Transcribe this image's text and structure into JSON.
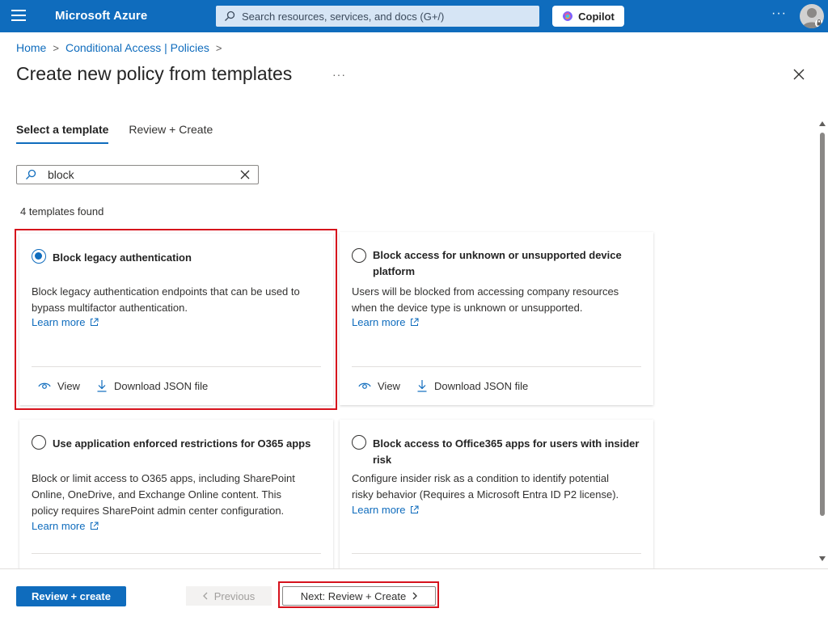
{
  "topbar": {
    "brand": "Microsoft Azure",
    "search_placeholder": "Search resources, services, and docs (G+/)",
    "copilot_label": "Copilot",
    "more_label": "···"
  },
  "breadcrumb": {
    "items": [
      "Home",
      "Conditional Access | Policies"
    ],
    "separator": ">"
  },
  "page": {
    "title": "Create new policy from templates",
    "title_more": "···"
  },
  "tabs": [
    {
      "label": "Select a template",
      "active": true
    },
    {
      "label": "Review + Create",
      "active": false
    }
  ],
  "filter": {
    "value": "block"
  },
  "results_count": "4 templates found",
  "cards": [
    {
      "title": "Block legacy authentication",
      "selected": true,
      "description": "Block legacy authentication endpoints that can be used to bypass multifactor authentication.",
      "learn_more": "Learn more",
      "view_label": "View",
      "download_label": "Download JSON file"
    },
    {
      "title": "Block access for unknown or unsupported device platform",
      "selected": false,
      "description": "Users will be blocked from accessing company resources when the device type is unknown or unsupported.",
      "learn_more": "Learn more",
      "view_label": "View",
      "download_label": "Download JSON file"
    },
    {
      "title": "Use application enforced restrictions for O365 apps",
      "selected": false,
      "description": "Block or limit access to O365 apps, including SharePoint Online, OneDrive, and Exchange Online content. This policy requires SharePoint admin center configuration.",
      "learn_more": "Learn more"
    },
    {
      "title": "Block access to Office365 apps for users with insider risk",
      "selected": false,
      "description": "Configure insider risk as a condition to identify potential risky behavior (Requires a Microsoft Entra ID P2 license).",
      "learn_more": "Learn more"
    }
  ],
  "footer": {
    "review_create": "Review + create",
    "previous": "Previous",
    "next": "Next: Review + Create"
  },
  "colors": {
    "accent": "#0f6cbd",
    "highlight": "#d6121c"
  }
}
